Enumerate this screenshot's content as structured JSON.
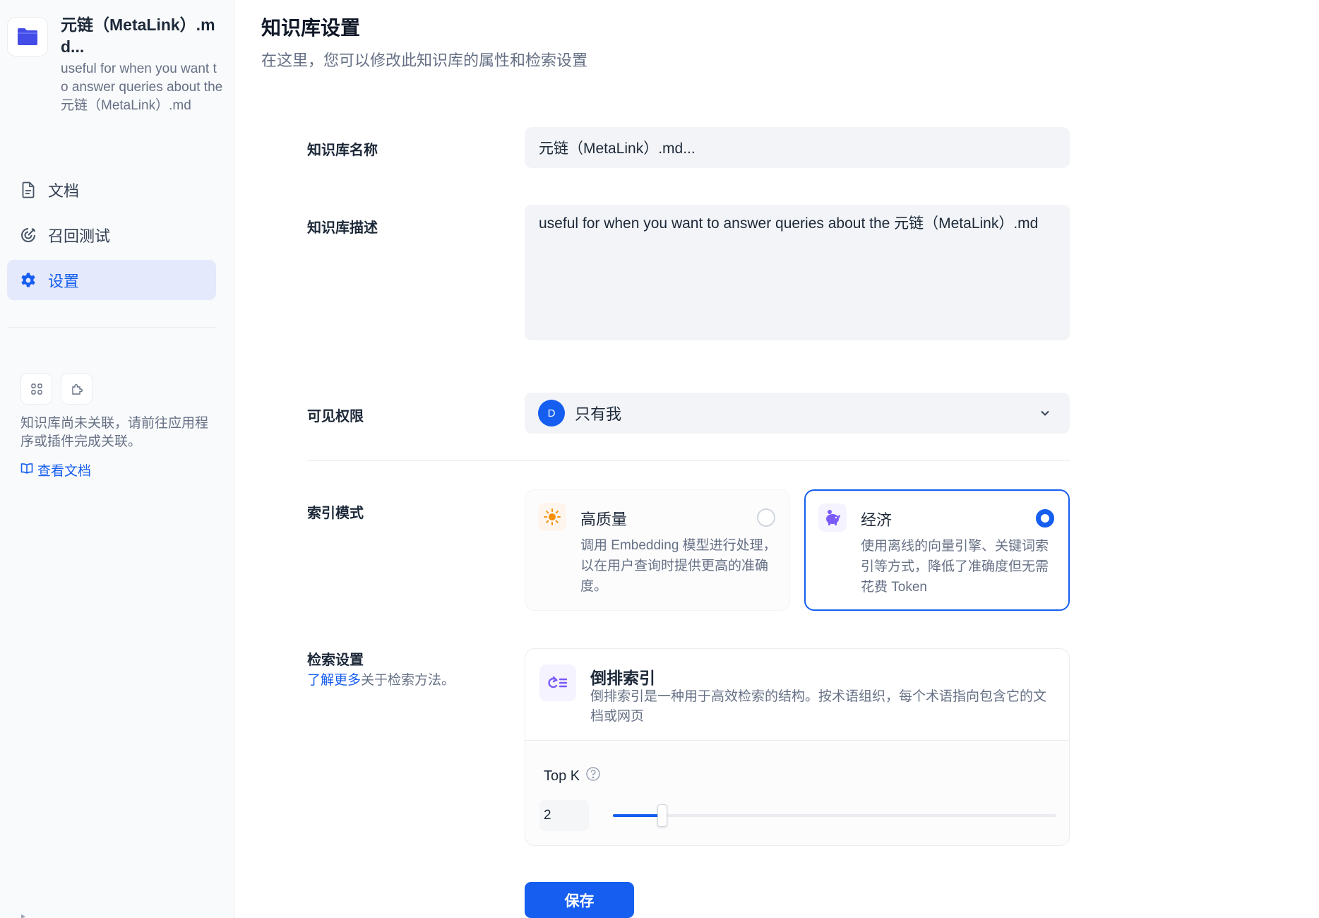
{
  "sidebar": {
    "kb_title": "元链（MetaLink）.md...",
    "kb_desc": "useful for when you want to answer queries about the 元链（MetaLink）.md",
    "nav": [
      {
        "label": "文档",
        "icon": "document-icon"
      },
      {
        "label": "召回测试",
        "icon": "target-icon"
      },
      {
        "label": "设置",
        "icon": "gear-icon"
      }
    ],
    "active_nav": 2,
    "assoc_text": "知识库尚未关联，请前往应用程序或插件完成关联。",
    "docs_link": "查看文档"
  },
  "header": {
    "title": "知识库设置",
    "subtitle": "在这里，您可以修改此知识库的属性和检索设置"
  },
  "form": {
    "name_label": "知识库名称",
    "name_value": "元链（MetaLink）.md...",
    "desc_label": "知识库描述",
    "desc_value": "useful for when you want to answer queries about the 元链（MetaLink）.md",
    "perm_label": "可见权限",
    "perm_avatar": "D",
    "perm_value": "只有我",
    "index_label": "索引模式",
    "index_modes": [
      {
        "title": "高质量",
        "desc": "调用 Embedding 模型进行处理，以在用户查询时提供更高的准确度。",
        "icon": "sun-icon",
        "selected": false
      },
      {
        "title": "经济",
        "desc": "使用离线的向量引擎、关键词索引等方式，降低了准确度但无需花费 Token",
        "icon": "piggy-bank-icon",
        "selected": true
      }
    ],
    "retrieval_label": "检索设置",
    "retrieval_link": "了解更多",
    "retrieval_sub": "关于检索方法。",
    "retrieval_method": {
      "title": "倒排索引",
      "desc": "倒排索引是一种用于高效检索的结构。按术语组织，每个术语指向包含它的文档或网页",
      "icon": "inverted-index-icon"
    },
    "topk_label": "Top K",
    "topk_value": "2",
    "topk_min": 1,
    "topk_max": 10,
    "save_label": "保存"
  },
  "colors": {
    "accent": "#155eef",
    "active_nav_bg": "#e4e9fb",
    "high_quality_icon": "#f79009",
    "economy_icon": "#7a5af8"
  }
}
